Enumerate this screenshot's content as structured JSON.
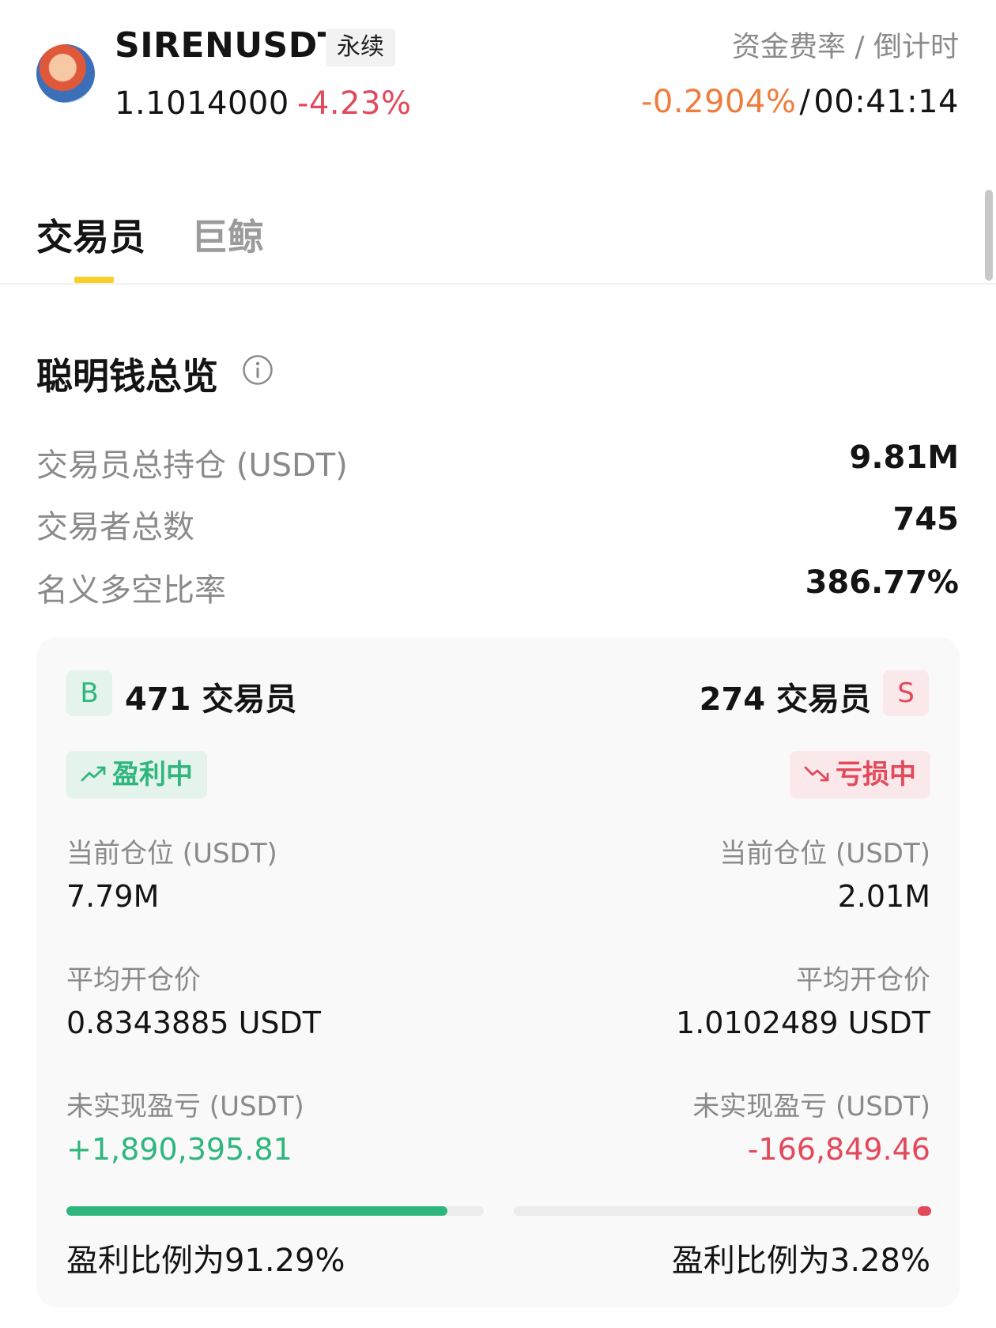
{
  "header": {
    "symbol": "SIRENUSDT",
    "contract_tag": "永续",
    "price": "1.1014000",
    "change": "-4.23%",
    "funding_label": "资金费率 / 倒计时",
    "funding_rate": "-0.2904%",
    "funding_separator": "/",
    "countdown": "00:41:14",
    "avatar_icon": "token-avatar-icon"
  },
  "tabs": [
    {
      "label": "交易员",
      "active": true
    },
    {
      "label": "巨鲸",
      "active": false
    }
  ],
  "overview": {
    "title": "聪明钱总览",
    "info_icon": "info-icon",
    "stats": [
      {
        "label": "交易员总持仓 (USDT)",
        "value": "9.81M"
      },
      {
        "label": "交易者总数",
        "value": "745"
      },
      {
        "label": "名义多空比率",
        "value": "386.77%"
      }
    ]
  },
  "long": {
    "badge": "B",
    "count_label": "471 交易员",
    "status": "盈利中",
    "status_icon": "trend-up-icon",
    "position_label": "当前仓位 (USDT)",
    "position_value": "7.79M",
    "avg_price_label": "平均开仓价",
    "avg_price_value": "0.8343885 USDT",
    "pnl_label": "未实现盈亏 (USDT)",
    "pnl_value": "+1,890,395.81",
    "profit_ratio": 0.9129,
    "ratio_text": "盈利比例为91.29%"
  },
  "short": {
    "badge": "S",
    "count_label": "274 交易员",
    "status": "亏损中",
    "status_icon": "trend-down-icon",
    "position_label": "当前仓位 (USDT)",
    "position_value": "2.01M",
    "avg_price_label": "平均开仓价",
    "avg_price_value": "1.0102489 USDT",
    "pnl_label": "未实现盈亏 (USDT)",
    "pnl_value": "-166,849.46",
    "profit_ratio": 0.0328,
    "ratio_text": "盈利比例为3.28%"
  },
  "colors": {
    "green": "#2eb67d",
    "red": "#e2495b",
    "orange": "#ee7e3d",
    "accent_yellow": "#f7d02a",
    "muted": "#8a8a8a"
  }
}
